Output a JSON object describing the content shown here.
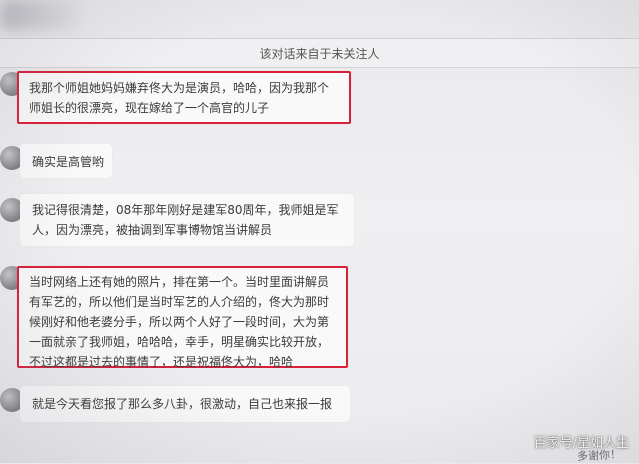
{
  "header": {
    "title": "该对话来自于未关注人"
  },
  "messages": [
    {
      "lines": [
        "我那个师姐她妈妈嫌弃佟大为是演员，哈哈，因为我那个",
        "师姐长的很漂亮，现在嫁给了一个高官的儿子"
      ],
      "highlighted": true
    },
    {
      "lines": [
        "确实是高管哟"
      ],
      "highlighted": false
    },
    {
      "lines": [
        "我记得很清楚，08年那年刚好是建军80周年，我师姐是军",
        "人，因为漂亮，被抽调到军事博物馆当讲解员"
      ],
      "highlighted": false
    },
    {
      "lines": [
        "当时网络上还有她的照片，排在第一个。当时里面讲解员",
        "有军艺的，所以他们是当时军艺的人介绍的，佟大为那时",
        "候刚好和他老婆分手，所以两个人好了一段时间，大为第",
        "一面就亲了我师姐，哈哈哈，幸手，明星确实比较开放，",
        "不过这都是过去的事情了，还是祝福佟大为，哈哈"
      ],
      "highlighted": true
    },
    {
      "lines": [
        "就是今天看您报了那么多八卦，很激动，自己也来报一报"
      ],
      "highlighted": false
    }
  ],
  "watermark": "百家号/星如人生",
  "corner_text": "多谢你！",
  "colors": {
    "highlight": "#d8203a",
    "bubble": "#f9f9fa",
    "background": "#ececee"
  }
}
